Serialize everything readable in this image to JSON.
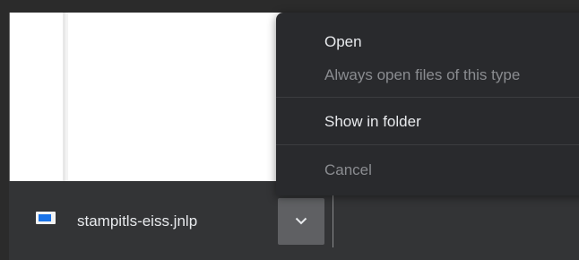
{
  "download": {
    "filename": "stampitls-eiss.jnlp",
    "file_icon": "jnlp-file-icon",
    "dropdown_icon": "chevron-down-icon"
  },
  "context_menu": {
    "items": [
      {
        "label": "Open",
        "enabled": true
      },
      {
        "label": "Always open files of this type",
        "enabled": false
      },
      {
        "label": "Show in folder",
        "enabled": true
      },
      {
        "label": "Cancel",
        "enabled": false
      }
    ]
  },
  "colors": {
    "menu_background": "#292a2d",
    "shelf_background": "#333436",
    "dropdown_active": "#5f6063",
    "file_icon_accent": "#1a73e8"
  }
}
